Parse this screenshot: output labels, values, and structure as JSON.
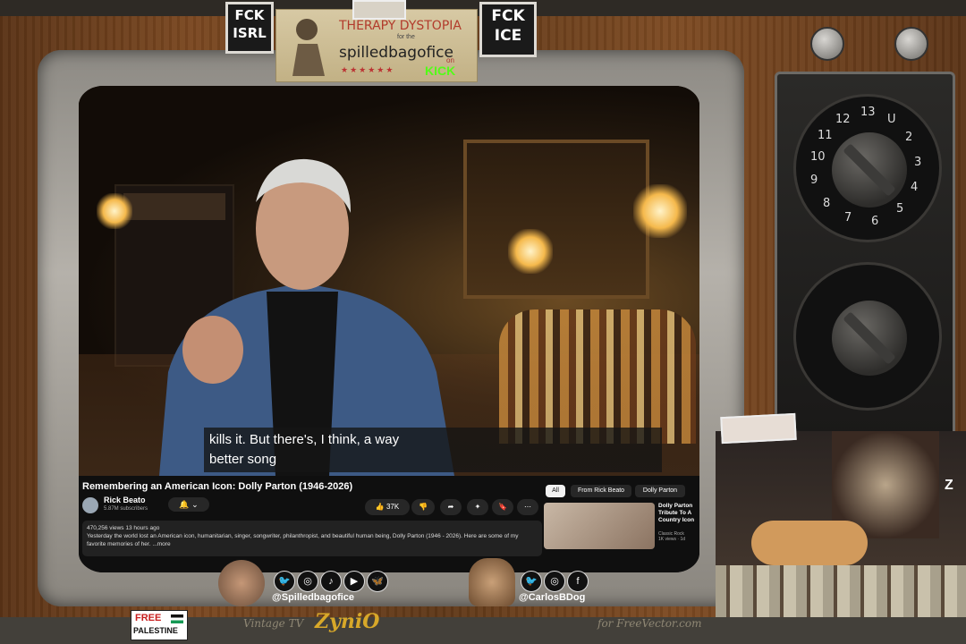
{
  "stickers": {
    "left_fck": {
      "top": "FCK",
      "bottom": "ISRL"
    },
    "right_fck": {
      "top": "FCK",
      "bottom": "ICE"
    }
  },
  "banner": {
    "line1": "THERAPY DYSTOPIA",
    "small": "for the",
    "line2": "spilledbagofice",
    "on": "on",
    "kick": "KICK"
  },
  "video": {
    "subtitle_line1": "kills it. But there's, I think, a way",
    "subtitle_line2": "better song"
  },
  "youtube": {
    "title": "Remembering an American Icon: Dolly Parton (1946-2026)",
    "channel": "Rick Beato",
    "subscribers": "5.87M subscribers",
    "like_count": "37K",
    "views": "470,256 views",
    "time_ago": "13 hours ago",
    "description": "Yesterday the world lost an American icon, humanitarian, singer, songwriter, philanthropist, and beautiful human being, Dolly Parton (1946 - 2026). Here are some of my favorite memories of her.",
    "more": "...more",
    "chips": [
      "All",
      "From Rick Beato",
      "Dolly Parton"
    ],
    "rec_title": "Dolly Parton Tribute To A Country Icon",
    "rec_channel": "Classic Rock",
    "rec_meta": "1K views · 1d"
  },
  "dial_numbers": [
    "12",
    "13",
    "U",
    "2",
    "3",
    "4",
    "5",
    "6",
    "7",
    "8",
    "9",
    "10",
    "11"
  ],
  "social": {
    "handle_left": "@Spilledbagofice",
    "handle_right": "@CarlosBDog"
  },
  "bottom": {
    "vintage": "Vintage TV",
    "brand": "ZyniO",
    "free_vector": "for FreeVector.com",
    "free": "FREE",
    "palestine": "PALESTINE"
  },
  "pip": {
    "sleep": "Z"
  }
}
